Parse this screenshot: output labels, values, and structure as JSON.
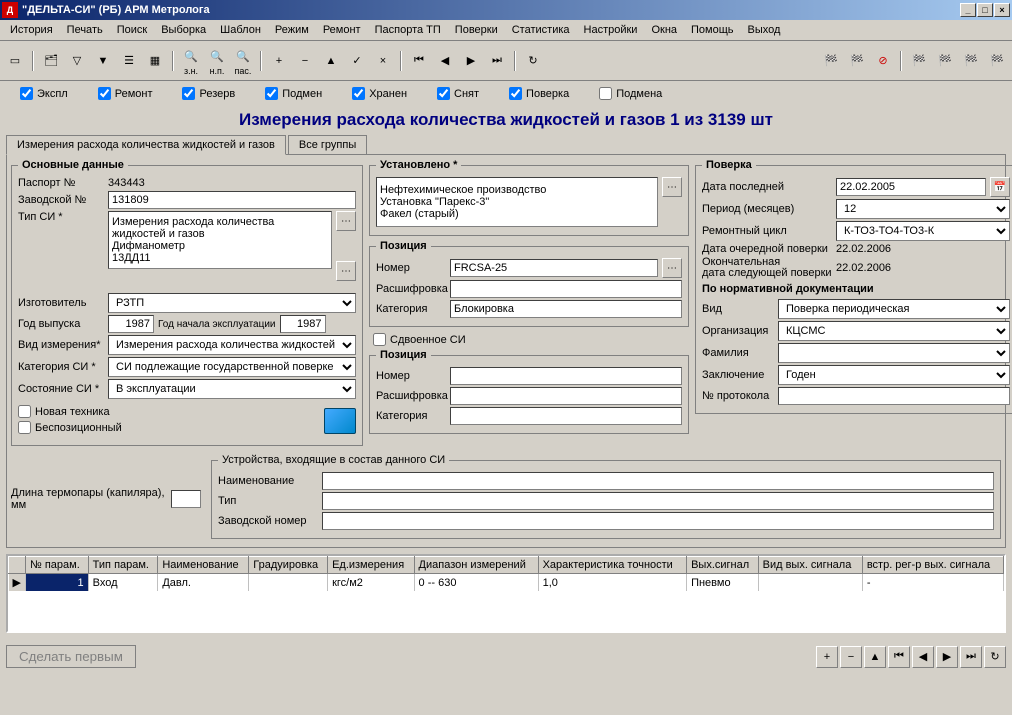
{
  "window": {
    "title": "\"ДЕЛЬТА-СИ\" (РБ) АРМ Метролога"
  },
  "menu": [
    "История",
    "Печать",
    "Поиск",
    "Выборка",
    "Шаблон",
    "Режим",
    "Ремонт",
    "Паспорта ТП",
    "Поверки",
    "Статистика",
    "Настройки",
    "Окна",
    "Помощь",
    "Выход"
  ],
  "toolbar": {
    "zn": "з.н.",
    "np": "н.п.",
    "pas": "пас."
  },
  "filters": [
    "Экспл",
    "Ремонт",
    "Резерв",
    "Подмен",
    "Хранен",
    "Снят",
    "Поверка",
    "Подмена"
  ],
  "header": "Измерения расхода количества жидкостей и газов  1 из 3139 шт",
  "tabs": [
    "Измерения расхода количества жидкостей и газов",
    "Все группы"
  ],
  "main": {
    "legend": "Основные данные",
    "passport_lbl": "Паспорт №",
    "passport": "343443",
    "factory_lbl": "Заводской №",
    "factory": "131809",
    "type_lbl": "Тип СИ *",
    "si_type": "Измерения расхода количества жидкостей и газов\nДифманометр\n13ДД11",
    "maker_lbl": "Изготовитель",
    "maker": "РЗТП",
    "year_lbl": "Год выпуска",
    "year": "1987",
    "start_lbl": "Год начала эксплуатации",
    "start_year": "1987",
    "meas_lbl": "Вид измерения*",
    "meas": "Измерения расхода количества жидкостей",
    "cat_lbl": "Категория СИ *",
    "cat": "СИ подлежащие государственной поверке",
    "state_lbl": "Состояние СИ *",
    "state": "В эксплуатации",
    "new_lbl": "Новая техника",
    "nopos_lbl": "Беспозиционный"
  },
  "install": {
    "legend": "Установлено *",
    "text": "Нефтехимическое производство\nУстановка \"Парекс-3\"\nФакел (старый)"
  },
  "pos1": {
    "legend": "Позиция",
    "num_lbl": "Номер",
    "num": "FRCSA-25",
    "desc_lbl": "Расшифровка",
    "desc": "",
    "cat_lbl": "Категория",
    "cat": "Блокировка"
  },
  "dual_lbl": "Сдвоенное СИ",
  "pos2": {
    "legend": "Позиция",
    "num_lbl": "Номер",
    "desc_lbl": "Расшифровка",
    "cat_lbl": "Категория"
  },
  "verify": {
    "legend": "Поверка",
    "last_lbl": "Дата последней",
    "last": "22.02.2005",
    "period_lbl": "Период  (месяцев)",
    "period": "12",
    "cycle_lbl": "Ремонтный цикл",
    "cycle": "К-ТО3-ТО4-ТО3-К",
    "next_lbl": "Дата очередной поверки",
    "next": "22.02.2006",
    "final_lbl": "Окончательная\nдата следующей поверки",
    "final": "22.02.2006",
    "norm_lbl": "По нормативной документации",
    "kind_lbl": "Вид",
    "kind": "Поверка периодическая",
    "org_lbl": "Организация",
    "org": "КЦСМС",
    "fam_lbl": "Фамилия",
    "fam": "",
    "concl_lbl": "Заключение",
    "concl": "Годен",
    "proto_lbl": "№ протокола",
    "proto": ""
  },
  "therm_lbl": "Длина термопары (капиляра), мм",
  "devices": {
    "legend": "Устройства, входящие  в состав данного СИ",
    "name_lbl": "Наименование",
    "type_lbl": "Тип",
    "factory_lbl": "Заводской номер"
  },
  "grid": {
    "cols": [
      "№ парам.",
      "Тип парам.",
      "Наименование",
      "Градуировка",
      "Ед.измерения",
      "Диапазон измерений",
      "Характеристика точности",
      "Вых.сигнал",
      "Вид вых. сигнала",
      "встр. рег-р вых. сигнала"
    ],
    "row": [
      "1",
      "Вход",
      "Давл.",
      "",
      "кгс/м2",
      "0 -- 630",
      "1,0",
      "Пневмо",
      "",
      "-"
    ]
  },
  "footer": {
    "first": "Сделать первым"
  }
}
